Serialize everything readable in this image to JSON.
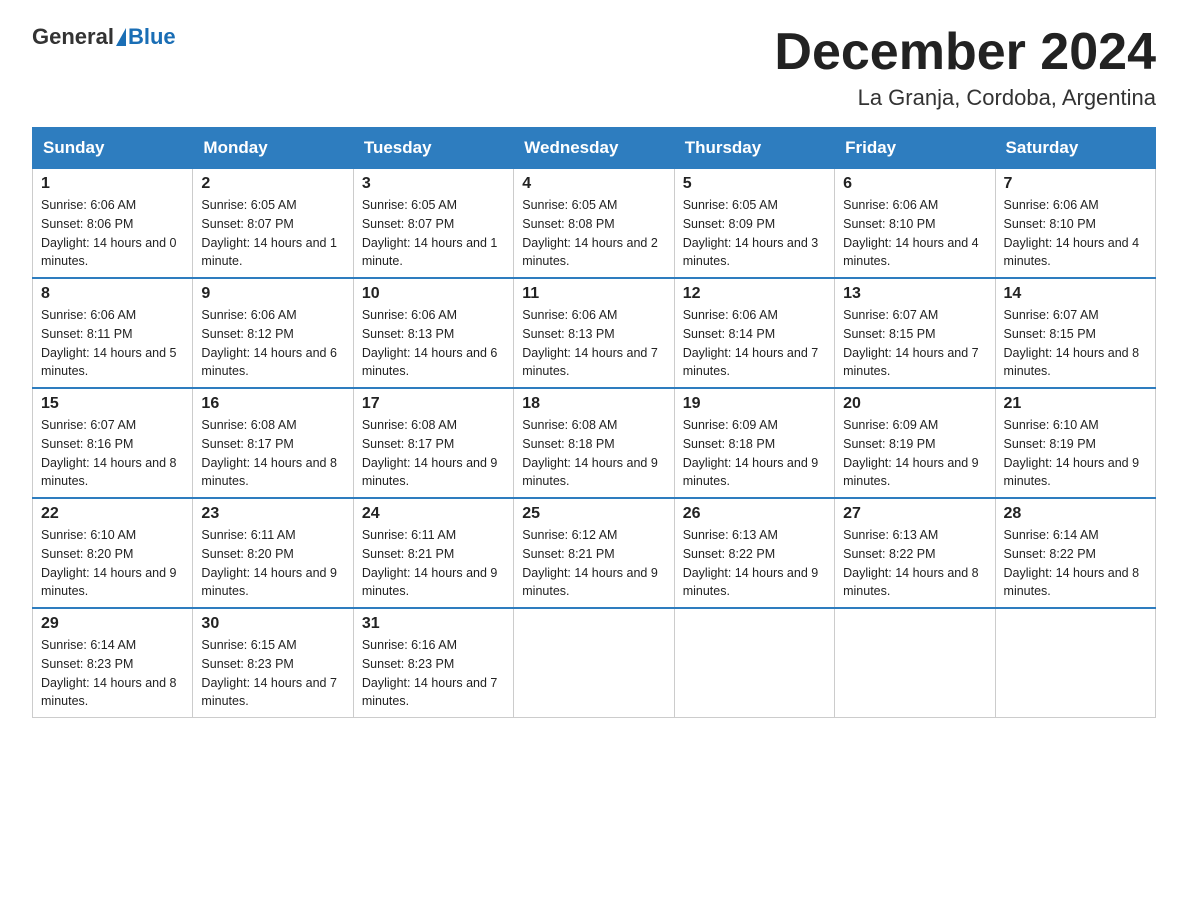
{
  "header": {
    "logo_general": "General",
    "logo_blue": "Blue",
    "month_title": "December 2024",
    "location": "La Granja, Cordoba, Argentina"
  },
  "days_of_week": [
    "Sunday",
    "Monday",
    "Tuesday",
    "Wednesday",
    "Thursday",
    "Friday",
    "Saturday"
  ],
  "weeks": [
    [
      {
        "day": "1",
        "sunrise": "6:06 AM",
        "sunset": "8:06 PM",
        "daylight": "14 hours and 0 minutes."
      },
      {
        "day": "2",
        "sunrise": "6:05 AM",
        "sunset": "8:07 PM",
        "daylight": "14 hours and 1 minute."
      },
      {
        "day": "3",
        "sunrise": "6:05 AM",
        "sunset": "8:07 PM",
        "daylight": "14 hours and 1 minute."
      },
      {
        "day": "4",
        "sunrise": "6:05 AM",
        "sunset": "8:08 PM",
        "daylight": "14 hours and 2 minutes."
      },
      {
        "day": "5",
        "sunrise": "6:05 AM",
        "sunset": "8:09 PM",
        "daylight": "14 hours and 3 minutes."
      },
      {
        "day": "6",
        "sunrise": "6:06 AM",
        "sunset": "8:10 PM",
        "daylight": "14 hours and 4 minutes."
      },
      {
        "day": "7",
        "sunrise": "6:06 AM",
        "sunset": "8:10 PM",
        "daylight": "14 hours and 4 minutes."
      }
    ],
    [
      {
        "day": "8",
        "sunrise": "6:06 AM",
        "sunset": "8:11 PM",
        "daylight": "14 hours and 5 minutes."
      },
      {
        "day": "9",
        "sunrise": "6:06 AM",
        "sunset": "8:12 PM",
        "daylight": "14 hours and 6 minutes."
      },
      {
        "day": "10",
        "sunrise": "6:06 AM",
        "sunset": "8:13 PM",
        "daylight": "14 hours and 6 minutes."
      },
      {
        "day": "11",
        "sunrise": "6:06 AM",
        "sunset": "8:13 PM",
        "daylight": "14 hours and 7 minutes."
      },
      {
        "day": "12",
        "sunrise": "6:06 AM",
        "sunset": "8:14 PM",
        "daylight": "14 hours and 7 minutes."
      },
      {
        "day": "13",
        "sunrise": "6:07 AM",
        "sunset": "8:15 PM",
        "daylight": "14 hours and 7 minutes."
      },
      {
        "day": "14",
        "sunrise": "6:07 AM",
        "sunset": "8:15 PM",
        "daylight": "14 hours and 8 minutes."
      }
    ],
    [
      {
        "day": "15",
        "sunrise": "6:07 AM",
        "sunset": "8:16 PM",
        "daylight": "14 hours and 8 minutes."
      },
      {
        "day": "16",
        "sunrise": "6:08 AM",
        "sunset": "8:17 PM",
        "daylight": "14 hours and 8 minutes."
      },
      {
        "day": "17",
        "sunrise": "6:08 AM",
        "sunset": "8:17 PM",
        "daylight": "14 hours and 9 minutes."
      },
      {
        "day": "18",
        "sunrise": "6:08 AM",
        "sunset": "8:18 PM",
        "daylight": "14 hours and 9 minutes."
      },
      {
        "day": "19",
        "sunrise": "6:09 AM",
        "sunset": "8:18 PM",
        "daylight": "14 hours and 9 minutes."
      },
      {
        "day": "20",
        "sunrise": "6:09 AM",
        "sunset": "8:19 PM",
        "daylight": "14 hours and 9 minutes."
      },
      {
        "day": "21",
        "sunrise": "6:10 AM",
        "sunset": "8:19 PM",
        "daylight": "14 hours and 9 minutes."
      }
    ],
    [
      {
        "day": "22",
        "sunrise": "6:10 AM",
        "sunset": "8:20 PM",
        "daylight": "14 hours and 9 minutes."
      },
      {
        "day": "23",
        "sunrise": "6:11 AM",
        "sunset": "8:20 PM",
        "daylight": "14 hours and 9 minutes."
      },
      {
        "day": "24",
        "sunrise": "6:11 AM",
        "sunset": "8:21 PM",
        "daylight": "14 hours and 9 minutes."
      },
      {
        "day": "25",
        "sunrise": "6:12 AM",
        "sunset": "8:21 PM",
        "daylight": "14 hours and 9 minutes."
      },
      {
        "day": "26",
        "sunrise": "6:13 AM",
        "sunset": "8:22 PM",
        "daylight": "14 hours and 9 minutes."
      },
      {
        "day": "27",
        "sunrise": "6:13 AM",
        "sunset": "8:22 PM",
        "daylight": "14 hours and 8 minutes."
      },
      {
        "day": "28",
        "sunrise": "6:14 AM",
        "sunset": "8:22 PM",
        "daylight": "14 hours and 8 minutes."
      }
    ],
    [
      {
        "day": "29",
        "sunrise": "6:14 AM",
        "sunset": "8:23 PM",
        "daylight": "14 hours and 8 minutes."
      },
      {
        "day": "30",
        "sunrise": "6:15 AM",
        "sunset": "8:23 PM",
        "daylight": "14 hours and 7 minutes."
      },
      {
        "day": "31",
        "sunrise": "6:16 AM",
        "sunset": "8:23 PM",
        "daylight": "14 hours and 7 minutes."
      },
      null,
      null,
      null,
      null
    ]
  ]
}
